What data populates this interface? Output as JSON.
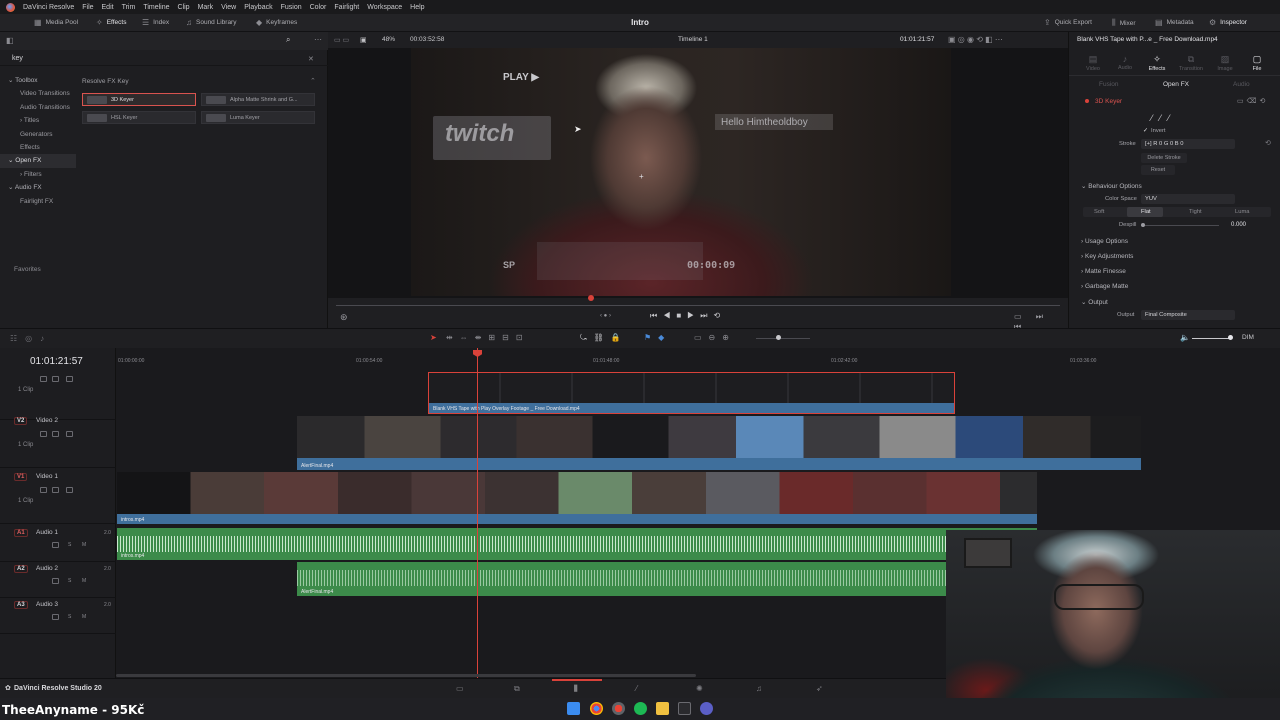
{
  "menubar": {
    "app_name": "DaVinci Resolve",
    "items": [
      "File",
      "Edit",
      "Trim",
      "Timeline",
      "Clip",
      "Mark",
      "View",
      "Playback",
      "Fusion",
      "Color",
      "Fairlight",
      "Workspace",
      "Help"
    ]
  },
  "toolbar": {
    "media_pool": "Media Pool",
    "effects": "Effects",
    "index": "Index",
    "sound_library": "Sound Library",
    "keyframes": "Keyframes",
    "project_title": "Intro",
    "quick_export": "Quick Export",
    "mixer": "Mixer",
    "metadata": "Metadata",
    "inspector": "Inspector"
  },
  "effects_panel": {
    "search_value": "key",
    "tree": [
      {
        "label": "Toolbox",
        "parent": true
      },
      {
        "label": "Video Transitions"
      },
      {
        "label": "Audio Transitions"
      },
      {
        "label": "Titles"
      },
      {
        "label": "Generators"
      },
      {
        "label": "Effects"
      },
      {
        "label": "Open FX",
        "parent": true,
        "selected": true
      },
      {
        "label": "Filters"
      },
      {
        "label": "Audio FX",
        "parent": true
      },
      {
        "label": "Fairlight FX"
      }
    ],
    "section_title": "Resolve FX Key",
    "tiles": [
      "3D Keyer",
      "Alpha Matte Shrink and G...",
      "HSL Keyer",
      "Luma Keyer"
    ],
    "favorites": "Favorites"
  },
  "viewer": {
    "zoom": "48%",
    "source_timecode": "00:03:52:58",
    "timeline_name": "Timeline 1",
    "record_timecode": "01:01:21:57",
    "overlay_play": "PLAY ▶",
    "overlay_twitch": "twitch",
    "overlay_hello": "Hello Himtheoldboy",
    "overlay_sp": "SP",
    "overlay_timer": "00:00:09"
  },
  "inspector": {
    "clip_title": "Blank VHS Tape with P...e _ Free Download.mp4",
    "tabs": [
      "Video",
      "Audio",
      "Effects",
      "Transition",
      "Image",
      "File"
    ],
    "active_tab": "Effects",
    "subtabs": [
      "Fusion",
      "Open FX",
      "Audio"
    ],
    "effect_name": "3D Keyer",
    "invert_label": "Invert",
    "stroke_label": "Stroke",
    "stroke_value": "R 0  G 0  B 0",
    "delete_stroke": "Delete Stroke",
    "reset": "Reset",
    "behaviour_options": "Behaviour Options",
    "color_space_label": "Color Space",
    "color_space_value": "YUV",
    "modes": [
      "Soft",
      "Flat",
      "Tight",
      "Luma"
    ],
    "active_mode": "Flat",
    "despill_label": "Despill",
    "despill_value": "0.000",
    "sections": [
      "Usage Options",
      "Key Adjustments",
      "Matte Finesse",
      "Garbage Matte",
      "Output"
    ],
    "output_label": "Output",
    "output_value": "Final Composite"
  },
  "timeline_toolbar": {
    "dim": "DIM"
  },
  "timeline": {
    "timecode": "01:01:21:57",
    "ruler": [
      "01:00:00:00",
      "01:00:54:00",
      "01:01:48:00",
      "01:02:42:00",
      "01:03:36:00"
    ],
    "tracks": [
      {
        "id": "",
        "name": "",
        "count": "1 Clip"
      },
      {
        "id": "V2",
        "name": "Video 2",
        "count": "1 Clip"
      },
      {
        "id": "V1",
        "name": "Video 1",
        "count": "1 Clip"
      },
      {
        "id": "A1",
        "name": "Audio 1",
        "level": "2.0"
      },
      {
        "id": "A2",
        "name": "Audio 2",
        "level": "2.0"
      },
      {
        "id": "A3",
        "name": "Audio 3",
        "level": "2.0"
      }
    ],
    "clips": {
      "v3": "Blank VHS Tape with Play Overlay Footage _ Free Download.mp4",
      "v2": "AlertFinal.mp4",
      "v1": "intros.mp4",
      "a1": "intros.mp4",
      "a2": "AlertFinal.mp4"
    }
  },
  "pagebar": {
    "brand": "DaVinci Resolve Studio 20"
  },
  "taskbar": {
    "streamer_text": "TheeAnyname - 95Kč"
  },
  "colors": {
    "accent_red": "#d9423a",
    "video_clip": "#3f6f9c",
    "audio_clip": "#3c8b4a"
  }
}
